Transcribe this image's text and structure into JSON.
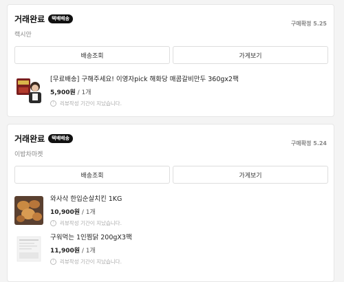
{
  "orders": [
    {
      "status": "거래완료",
      "badge": "택배배송",
      "seller": "랙시안",
      "confirm": "구매확정 5.25",
      "buttons": {
        "track": "배송조회",
        "store": "가게보기"
      },
      "items": [
        {
          "title": "[무료배송] 구해주세요! 이영자pick 해화당 매콤갈비만두 360gx2팩",
          "price": "5,900원",
          "qty": " / 1개",
          "review": "리뷰작성 기간이 지났습니다."
        }
      ]
    },
    {
      "status": "거래완료",
      "badge": "택배배송",
      "seller": "이밥차마켓",
      "confirm": "구매확정 5.24",
      "buttons": {
        "track": "배송조회",
        "store": "가게보기"
      },
      "items": [
        {
          "title": "와사삭 한입순살치킨 1KG",
          "price": "10,900원",
          "qty": " / 1개",
          "review": "리뷰작성 기간이 지났습니다."
        },
        {
          "title": "구워먹는 1인찜닭 200gX3팩",
          "price": "11,900원",
          "qty": " / 1개",
          "review": "리뷰작성 기간이 지났습니다."
        }
      ]
    }
  ]
}
